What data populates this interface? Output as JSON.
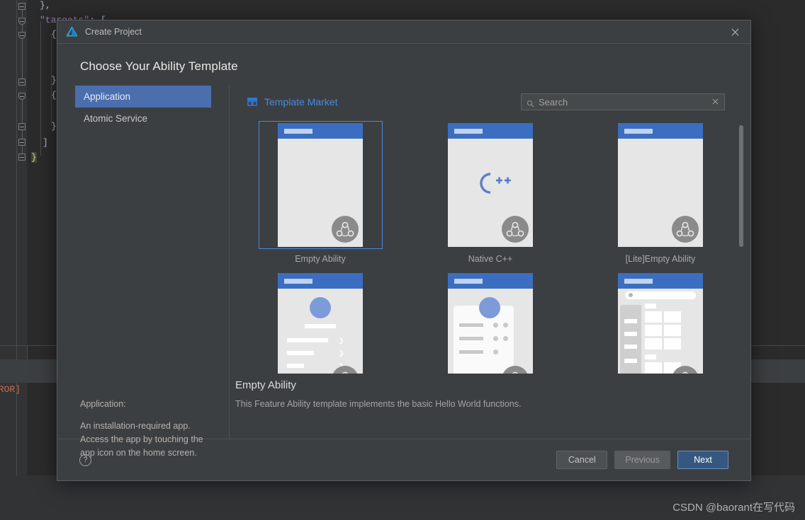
{
  "ide": {
    "code_lines": [
      "},",
      "\"targets\": [",
      "  {",
      "  }",
      "  {",
      "  }",
      "]",
      "}"
    ],
    "targets_key": "\"targets\"",
    "console_text": "RROR]"
  },
  "dialog": {
    "title": "Create Project",
    "app_icon": "deveco-logo-icon",
    "close_icon": "close-icon",
    "heading": "Choose Your Ability Template",
    "nav": {
      "items": [
        {
          "label": "Application",
          "selected": true
        },
        {
          "label": "Atomic Service",
          "selected": false
        }
      ]
    },
    "left_description": {
      "heading": "Application:",
      "body": "An installation-required app. Access the app by touching the app icon on the home screen."
    },
    "toolbar": {
      "market_link": "Template Market",
      "market_icon": "store-icon",
      "search_icon": "search-icon",
      "search_placeholder": "Search",
      "search_value": "",
      "search_clear_icon": "close-icon"
    },
    "templates": [
      {
        "label": "Empty Ability",
        "kind": "blank",
        "selected": true
      },
      {
        "label": "Native C++",
        "kind": "cpp",
        "selected": false
      },
      {
        "label": "[Lite]Empty Ability",
        "kind": "blank",
        "selected": false
      },
      {
        "label": "",
        "kind": "list",
        "selected": false
      },
      {
        "label": "",
        "kind": "card",
        "selected": false
      },
      {
        "label": "",
        "kind": "grid",
        "selected": false
      }
    ],
    "cpp_logo_text": "C++",
    "selection": {
      "title": "Empty Ability",
      "description": "This Feature Ability template implements the basic Hello World functions."
    },
    "footer": {
      "help_icon": "help-icon",
      "help_label": "?",
      "cancel_label": "Cancel",
      "previous_label": "Previous",
      "next_label": "Next"
    },
    "colors": {
      "accent": "#4a88e0",
      "selected_nav": "#4b6eaf",
      "primary_button": "#365880",
      "dialog_bg": "#3c3f41"
    }
  },
  "watermark": "CSDN @baorant在写代码"
}
